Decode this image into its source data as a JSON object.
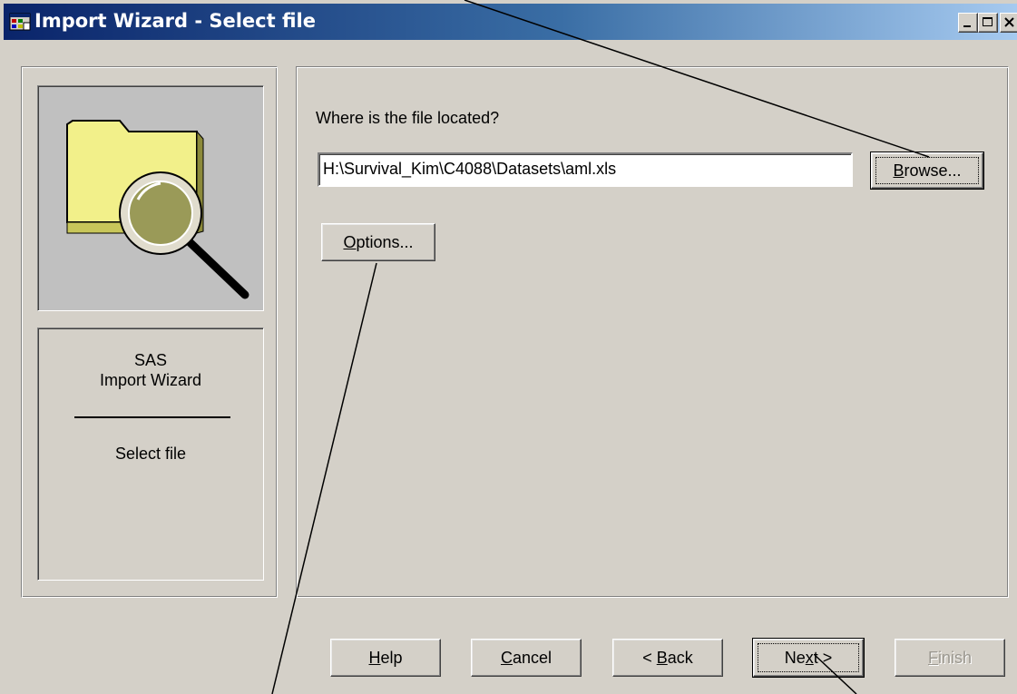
{
  "window": {
    "title": "Import Wizard - Select file",
    "icon": "sas-wizard-icon",
    "controls": [
      "minimize-icon",
      "maximize-icon",
      "close-icon"
    ]
  },
  "sidebar": {
    "illustration": "folder-magnifier-icon",
    "product": "SAS",
    "wizard": "Import Wizard",
    "step": "Select file"
  },
  "main": {
    "prompt": "Where is the file located?",
    "file_path": "H:\\Survival_Kim\\C4088\\Datasets\\aml.xls",
    "browse": {
      "prefix": "",
      "accel": "B",
      "rest": "rowse..."
    },
    "options": {
      "prefix": "",
      "accel": "O",
      "rest": "ptions..."
    }
  },
  "footer": {
    "help": {
      "prefix": "",
      "accel": "H",
      "rest": "elp"
    },
    "cancel": {
      "prefix": "",
      "accel": "C",
      "rest": "ancel"
    },
    "back": {
      "prefix": "< ",
      "accel": "B",
      "rest": "ack"
    },
    "next": {
      "prefix": "Ne",
      "accel": "x",
      "rest": "t >"
    },
    "finish": {
      "prefix": "",
      "accel": "F",
      "rest": "inish",
      "disabled": true
    }
  },
  "colors": {
    "face": "#d4d0c8",
    "title_start": "#0a246a",
    "title_end": "#a6caf0",
    "illustration_bg": "#c0c0c0",
    "folder": "#f2f08a"
  }
}
